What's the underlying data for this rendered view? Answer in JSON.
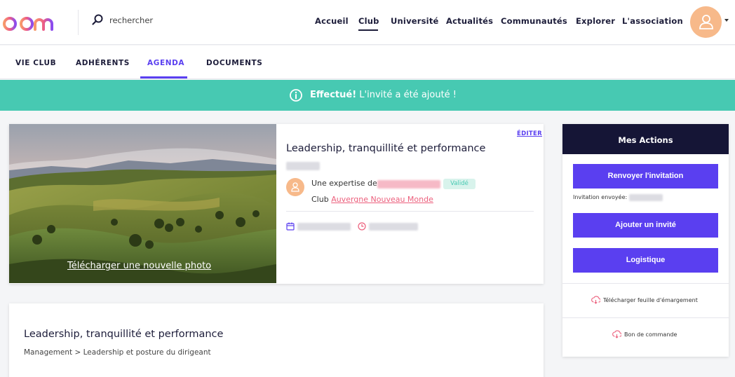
{
  "brand": {
    "logo_text": "apm",
    "accent": "#5a3ff0",
    "teal": "#47c9b2",
    "pink": "#ec5f7c",
    "navy": "#151536"
  },
  "search": {
    "placeholder": "rechercher"
  },
  "nav": {
    "items": [
      {
        "label": "Accueil"
      },
      {
        "label": "Club",
        "active": true
      },
      {
        "label": "Université"
      },
      {
        "label": "Actualités"
      },
      {
        "label": "Communautés"
      },
      {
        "label": "Explorer"
      },
      {
        "label": "L'association"
      }
    ]
  },
  "subnav": {
    "tabs": [
      {
        "label": "VIE CLUB"
      },
      {
        "label": "ADHÉRENTS"
      },
      {
        "label": "AGENDA",
        "active": true
      },
      {
        "label": "DOCUMENTS"
      }
    ]
  },
  "banner": {
    "strong": "Effectué!",
    "message": " L'invité a été ajouté !"
  },
  "event": {
    "edit_label": "ÉDITER",
    "title": "Leadership, tranquillité et performance",
    "expertise_label": "Une expertise de",
    "badge": "Validé",
    "club_prefix": "Club ",
    "club_name": "Auvergne Nouveau Monde",
    "photo_link": "Télécharger une nouvelle photo"
  },
  "details": {
    "title": "Leadership, tranquillité et performance",
    "category": "Management > Leadership et posture du dirigeant"
  },
  "actions": {
    "header": "Mes Actions",
    "resend_label": "Renvoyer l'invitation",
    "sent_label": "Invitation envoyée:",
    "add_guest_label": "Ajouter un invité",
    "logistics_label": "Logistique",
    "download_sheet_label": "Télécharger feuille d'émargement",
    "order_label": "Bon de commande"
  }
}
